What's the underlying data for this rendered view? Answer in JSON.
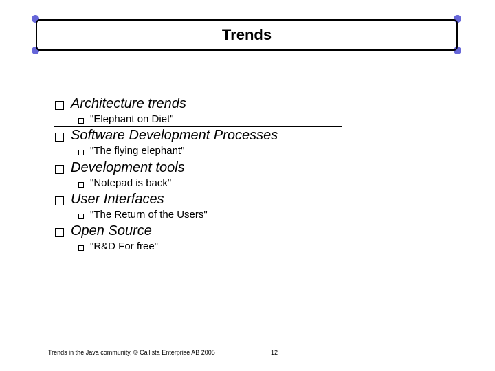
{
  "title": "Trends",
  "items": [
    {
      "label": "Architecture trends",
      "sub": "\"Elephant on Diet\"",
      "highlighted": false
    },
    {
      "label": "Software Development Processes",
      "sub": "\"The flying elephant\"",
      "highlighted": true
    },
    {
      "label": "Development tools",
      "sub": "\"Notepad is back\"",
      "highlighted": false
    },
    {
      "label": "User Interfaces",
      "sub": "\"The Return of the Users\"",
      "highlighted": false
    },
    {
      "label": "Open Source",
      "sub": "\"R&D For free\"",
      "highlighted": false
    }
  ],
  "footer": "Trends in the Java community, © Callista Enterprise AB 2005",
  "page_number": "12"
}
